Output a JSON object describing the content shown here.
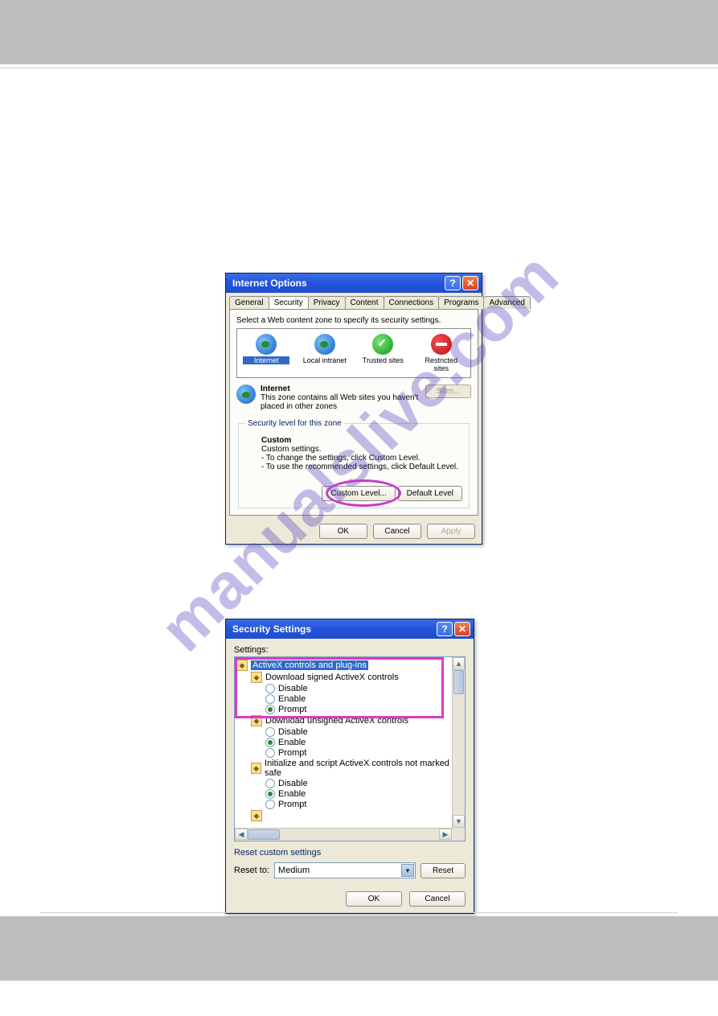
{
  "watermark": "manualslive.com",
  "dialog1": {
    "title": "Internet Options",
    "tabs": [
      "General",
      "Security",
      "Privacy",
      "Content",
      "Connections",
      "Programs",
      "Advanced"
    ],
    "active_tab": "Security",
    "zone_instruction": "Select a Web content zone to specify its security settings.",
    "zones": [
      {
        "label": "Internet",
        "selected": true
      },
      {
        "label": "Local intranet",
        "selected": false
      },
      {
        "label": "Trusted sites",
        "selected": false
      },
      {
        "label": "Restricted sites",
        "selected": false
      }
    ],
    "zone_desc_title": "Internet",
    "zone_desc_body": "This zone contains all Web sites you haven't placed in other zones",
    "sites_button": "Sites...",
    "fieldset_legend": "Security level for this zone",
    "custom_heading": "Custom",
    "custom_line1": "Custom settings.",
    "custom_line2": "- To change the settings, click Custom Level.",
    "custom_line3": "- To use the recommended settings, click Default Level.",
    "custom_level_button": "Custom Level...",
    "default_level_button": "Default Level",
    "ok": "OK",
    "cancel": "Cancel",
    "apply": "Apply"
  },
  "dialog2": {
    "title": "Security Settings",
    "settings_label": "Settings:",
    "tree": {
      "group": "ActiveX controls and plug-ins",
      "items": [
        {
          "label": "Download signed ActiveX controls",
          "options": [
            "Disable",
            "Enable",
            "Prompt"
          ],
          "selected": "Prompt"
        },
        {
          "label": "Download unsigned ActiveX controls",
          "options": [
            "Disable",
            "Enable",
            "Prompt"
          ],
          "selected": "Enable"
        },
        {
          "label": "Initialize and script ActiveX controls not marked as safe",
          "options": [
            "Disable",
            "Enable",
            "Prompt"
          ],
          "selected": "Enable"
        }
      ]
    },
    "reset_section": "Reset custom settings",
    "reset_to_label": "Reset to:",
    "reset_to_value": "Medium",
    "reset_button": "Reset",
    "ok": "OK",
    "cancel": "Cancel"
  }
}
